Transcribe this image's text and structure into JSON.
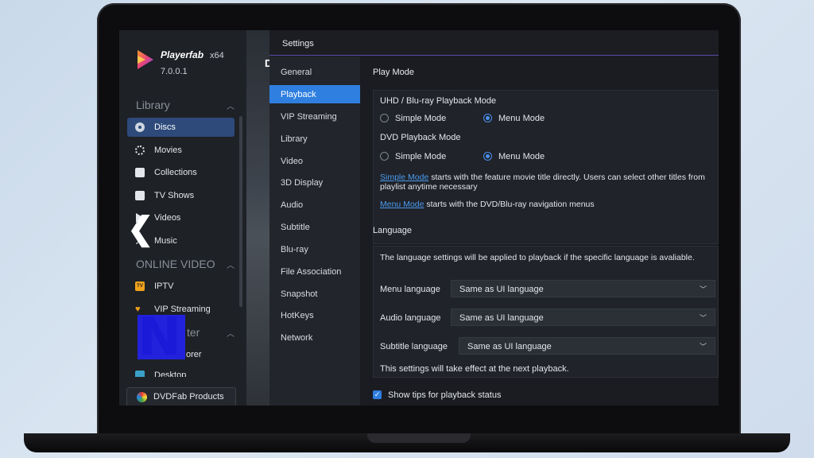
{
  "app": {
    "name": "Playerfab",
    "arch": "x64",
    "version": "7.0.0.1"
  },
  "sidebar": {
    "library_heading": "Library",
    "library_items": [
      {
        "label": "Discs",
        "icon": "disc-icon",
        "active": true
      },
      {
        "label": "Movies",
        "icon": "film-reel-icon"
      },
      {
        "label": "Collections",
        "icon": "collections-icon"
      },
      {
        "label": "TV Shows",
        "icon": "tv-icon"
      },
      {
        "label": "Videos",
        "icon": "play-icon"
      },
      {
        "label": "Music",
        "icon": "music-note-icon"
      }
    ],
    "online_heading": "ONLINE VIDEO",
    "online_items": [
      {
        "label": "IPTV",
        "icon": "iptv-icon"
      },
      {
        "label": "VIP Streaming",
        "icon": "vip-crown-icon"
      }
    ],
    "media_heading_partial": "ter",
    "media_item_partial": "orer",
    "media_item_partial2": "Desktop",
    "products_label": "DVDFab Products"
  },
  "scenic": {
    "letter": "D"
  },
  "settings": {
    "title": "Settings",
    "nav": [
      {
        "label": "General"
      },
      {
        "label": "Playback",
        "active": true
      },
      {
        "label": "VIP Streaming"
      },
      {
        "label": "Library"
      },
      {
        "label": "Video"
      },
      {
        "label": "3D Display"
      },
      {
        "label": "Audio"
      },
      {
        "label": "Subtitle"
      },
      {
        "label": "Blu-ray"
      },
      {
        "label": "File Association"
      },
      {
        "label": "Snapshot"
      },
      {
        "label": "HotKeys"
      },
      {
        "label": "Network"
      }
    ],
    "play_mode": {
      "heading": "Play Mode",
      "uhd_label": "UHD / Blu-ray Playback Mode",
      "dvd_label": "DVD Playback Mode",
      "simple_mode": "Simple Mode",
      "menu_mode": "Menu Mode",
      "uhd_selected": "Menu Mode",
      "dvd_selected": "Menu Mode",
      "simple_link": "Simple Mode",
      "simple_desc": " starts with the feature movie title directly. Users can select other titles from playlist anytime necessary",
      "menu_link": "Menu Mode",
      "menu_desc": " starts with the DVD/Blu-ray navigation menus"
    },
    "language": {
      "heading": "Language",
      "note": "The language settings will be applied to playback if the specific language is avaliable.",
      "menu_language_label": "Menu language",
      "menu_language_value": "Same as UI language",
      "audio_language_label": "Audio language",
      "audio_language_value": "Same as UI language",
      "subtitle_language_label": "Subtitle language",
      "subtitle_language_value": "Same as UI language",
      "effect_note": "This settings will take effect at the next playback."
    },
    "tips_checkbox_label": "Show tips for playback status",
    "tips_checked": true
  }
}
